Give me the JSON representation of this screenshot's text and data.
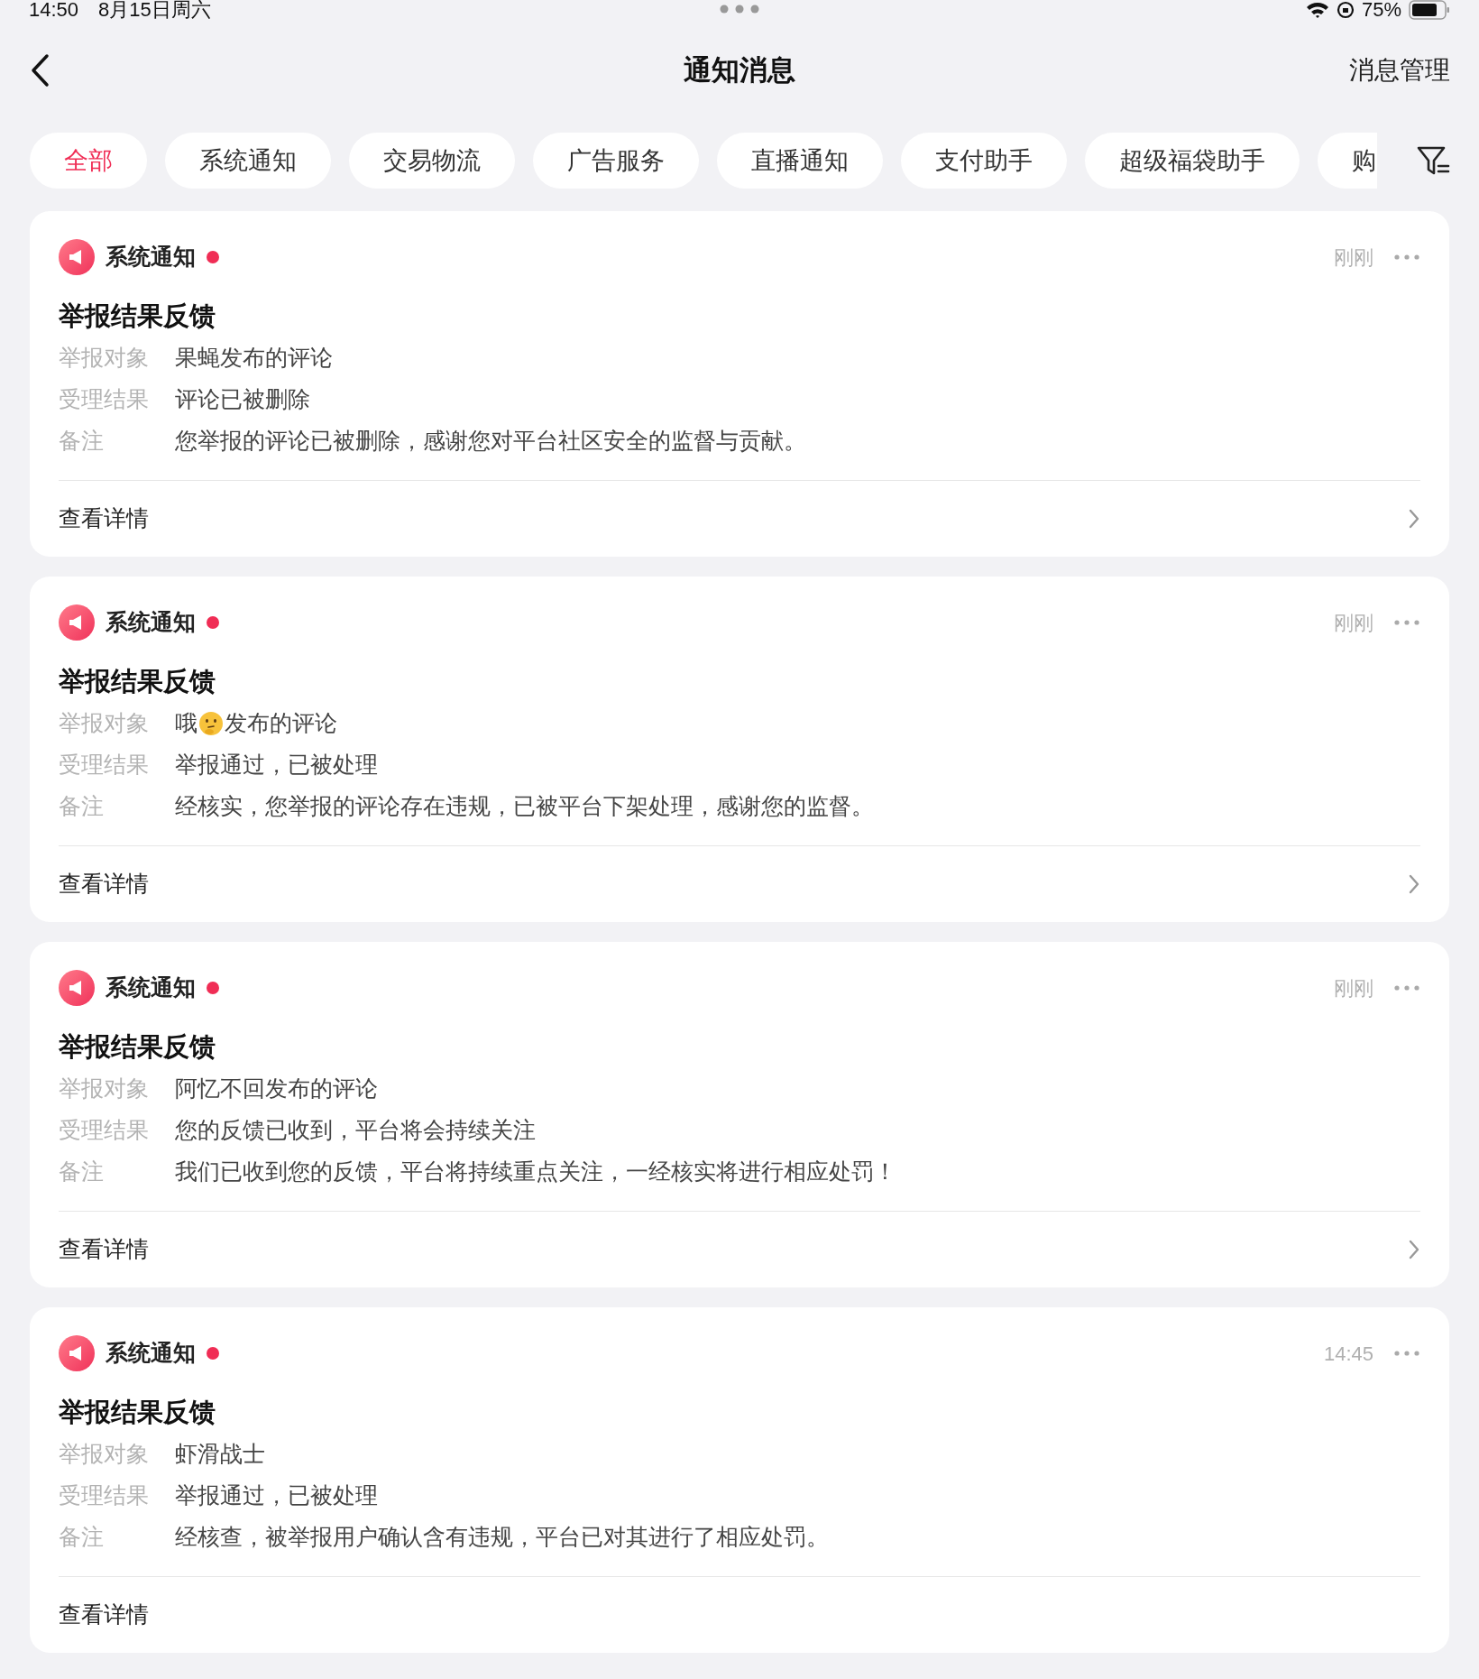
{
  "status_bar": {
    "time": "14:50",
    "date": "8月15日周六",
    "battery": "75%"
  },
  "header": {
    "title": "通知消息",
    "action": "消息管理"
  },
  "tabs": [
    {
      "label": "全部",
      "selected": true
    },
    {
      "label": "系统通知",
      "selected": false
    },
    {
      "label": "交易物流",
      "selected": false
    },
    {
      "label": "广告服务",
      "selected": false
    },
    {
      "label": "直播通知",
      "selected": false
    },
    {
      "label": "支付助手",
      "selected": false
    },
    {
      "label": "超级福袋助手",
      "selected": false
    },
    {
      "label": "购",
      "selected": false
    }
  ],
  "cards": [
    {
      "source": "系统通知",
      "unread": true,
      "time": "刚刚",
      "title": "举报结果反馈",
      "rows": [
        {
          "label": "举报对象",
          "parts": [
            {
              "kind": "text",
              "text": "果蝇发布的评论"
            }
          ]
        },
        {
          "label": "受理结果",
          "parts": [
            {
              "kind": "text",
              "text": "评论已被删除"
            }
          ]
        },
        {
          "label": "备注",
          "parts": [
            {
              "kind": "text",
              "text": "您举报的评论已被删除，感谢您对平台社区安全的监督与贡献。"
            }
          ]
        }
      ],
      "link": "查看详情",
      "arrow": true
    },
    {
      "source": "系统通知",
      "unread": true,
      "time": "刚刚",
      "title": "举报结果反馈",
      "rows": [
        {
          "label": "举报对象",
          "parts": [
            {
              "kind": "text",
              "text": "哦"
            },
            {
              "kind": "emoji"
            },
            {
              "kind": "text",
              "text": "发布的评论"
            }
          ]
        },
        {
          "label": "受理结果",
          "parts": [
            {
              "kind": "text",
              "text": "举报通过，已被处理"
            }
          ]
        },
        {
          "label": "备注",
          "parts": [
            {
              "kind": "text",
              "text": "经核实，您举报的评论存在违规，已被平台下架处理，感谢您的监督。"
            }
          ]
        }
      ],
      "link": "查看详情",
      "arrow": true
    },
    {
      "source": "系统通知",
      "unread": true,
      "time": "刚刚",
      "title": "举报结果反馈",
      "rows": [
        {
          "label": "举报对象",
          "parts": [
            {
              "kind": "text",
              "text": "阿忆不回发布的评论"
            }
          ]
        },
        {
          "label": "受理结果",
          "parts": [
            {
              "kind": "text",
              "text": "您的反馈已收到，平台将会持续关注"
            }
          ]
        },
        {
          "label": "备注",
          "parts": [
            {
              "kind": "text",
              "text": "我们已收到您的反馈，平台将持续重点关注，一经核实将进行相应处罚！"
            }
          ]
        }
      ],
      "link": "查看详情",
      "arrow": true
    },
    {
      "source": "系统通知",
      "unread": true,
      "time": "14:45",
      "title": "举报结果反馈",
      "rows": [
        {
          "label": "举报对象",
          "parts": [
            {
              "kind": "text",
              "text": "虾滑战士"
            }
          ]
        },
        {
          "label": "受理结果",
          "parts": [
            {
              "kind": "text",
              "text": "举报通过，已被处理"
            }
          ]
        },
        {
          "label": "备注",
          "parts": [
            {
              "kind": "text",
              "text": "经核查，被举报用户确认含有违规，平台已对其进行了相应处罚。"
            }
          ]
        }
      ],
      "link": "查看详情",
      "arrow": false
    }
  ]
}
